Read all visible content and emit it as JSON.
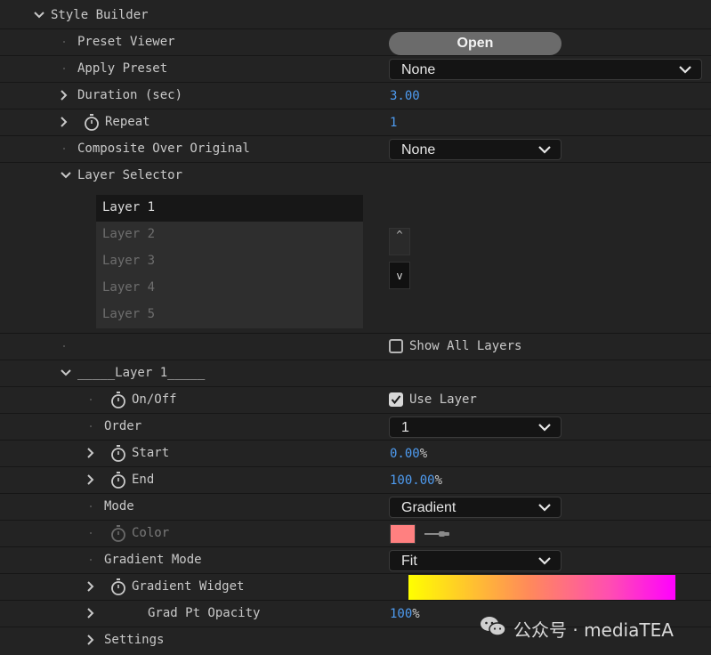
{
  "tree": {
    "style_builder": "Style Builder",
    "preset_viewer": "Preset Viewer",
    "preset_viewer_button": "Open",
    "apply_preset": "Apply Preset",
    "apply_preset_value": "None",
    "duration": "Duration (sec)",
    "duration_value": "3.00",
    "repeat": "Repeat",
    "repeat_value": "1",
    "composite": "Composite Over Original",
    "composite_value": "None",
    "layer_selector": "Layer Selector",
    "layers": [
      "Layer 1",
      "Layer 2",
      "Layer 3",
      "Layer 4",
      "Layer 5"
    ],
    "selected_layer": "Layer 1",
    "move_up": "^",
    "move_down": "v",
    "show_all_layers": "Show All Layers",
    "show_all_layers_checked": false,
    "layer_group": "_____Layer 1_____",
    "on_off": "On/Off",
    "use_layer": "Use Layer",
    "use_layer_checked": true,
    "order": "Order",
    "order_value": "1",
    "start": "Start",
    "start_value": "0.00",
    "start_unit": "%",
    "end": "End",
    "end_value": "100.00",
    "end_unit": "%",
    "mode": "Mode",
    "mode_value": "Gradient",
    "color": "Color",
    "color_value": "#ff8080",
    "gradient_mode": "Gradient Mode",
    "gradient_mode_value": "Fit",
    "gradient_widget": "Gradient Widget",
    "gradient_colors": [
      "#ffff00",
      "#ff8a5a",
      "#ff4fb0",
      "#ff00ff"
    ],
    "grad_pt_opacity": "Grad Pt Opacity",
    "grad_pt_opacity_value": "100",
    "grad_pt_opacity_unit": "%",
    "settings": "Settings"
  },
  "watermark": "公众号 · mediaTEA",
  "colors": {
    "background": "#232323",
    "value_blue": "#4e9bf0",
    "text": "#c9c9c9"
  }
}
